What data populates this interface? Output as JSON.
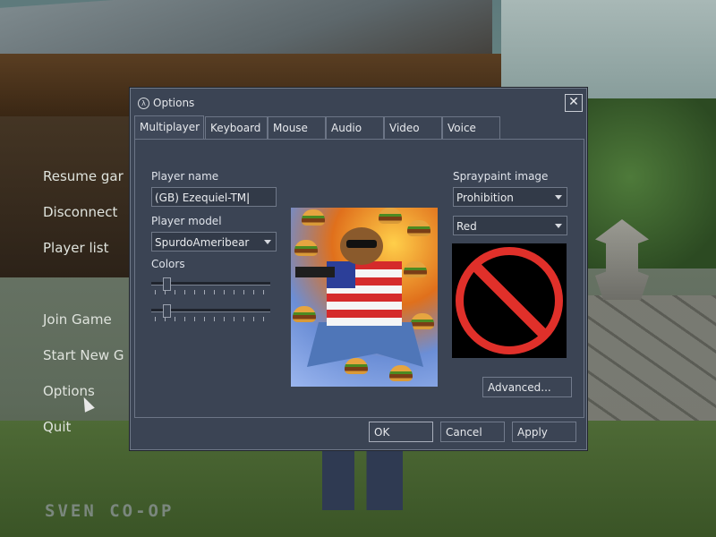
{
  "main_menu": {
    "items": [
      "Resume gar",
      "Disconnect",
      "Player list",
      "Join Game",
      "Start New G",
      "Options",
      "Quit"
    ],
    "brand": "SVEN CO-OP"
  },
  "dialog": {
    "title": "Options",
    "close_icon": "close-icon",
    "tabs": [
      "Multiplayer",
      "Keyboard",
      "Mouse",
      "Audio",
      "Video",
      "Voice"
    ],
    "active_tab": "Multiplayer",
    "player_name_label": "Player name",
    "player_name_value": "(GB) Ezequiel-TM",
    "player_model_label": "Player model",
    "player_model_value": "SpurdoAmeribear",
    "colors_label": "Colors",
    "color_slider_1": 0.1,
    "color_slider_2": 0.1,
    "spray_label": "Spraypaint image",
    "spray_image_value": "Prohibition",
    "spray_color_value": "Red",
    "advanced_button": "Advanced...",
    "ok_button": "OK",
    "cancel_button": "Cancel",
    "apply_button": "Apply"
  },
  "colors": {
    "spray_red": "#e0302a",
    "dialog_bg": "#3b4454"
  }
}
